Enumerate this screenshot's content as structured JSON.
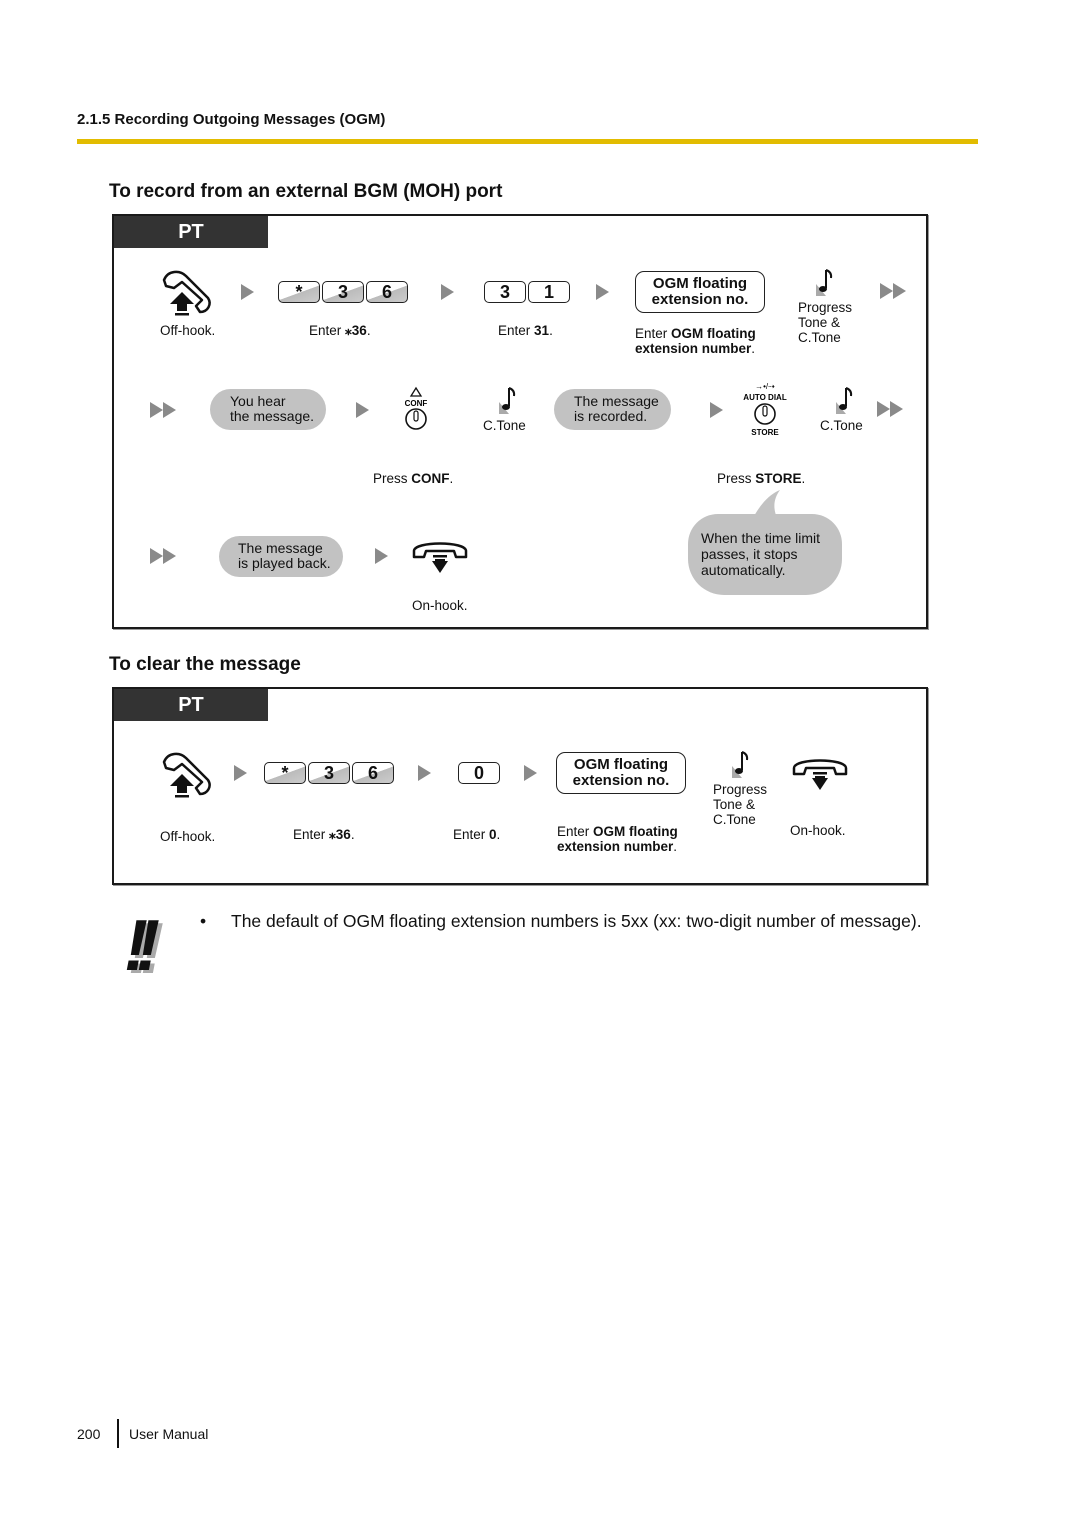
{
  "header": {
    "section": "2.1.5 Recording Outgoing Messages (OGM)",
    "accent_color": "#e2bc00"
  },
  "record_section": {
    "title": "To record from an external BGM (MOH) port",
    "badge": "PT",
    "row1": {
      "offhook_label": "Off-hook.",
      "keys_a": [
        "*",
        "3",
        "6"
      ],
      "keys_a_label_prefix": "Enter ",
      "keys_a_label_bold": "⁎36",
      "keys_a_label_suffix": ".",
      "keys_b": [
        "3",
        "1"
      ],
      "keys_b_label_prefix": "Enter ",
      "keys_b_label_bold": "31",
      "keys_b_label_suffix": ".",
      "ogm_box_line1": "OGM floating",
      "ogm_box_line2": "extension no.",
      "ogm_label_prefix": "Enter ",
      "ogm_label_bold1": "OGM floating",
      "ogm_label_bold2": "extension number",
      "ogm_label_suffix": ".",
      "tone_line1": "Progress",
      "tone_line2": "Tone &",
      "tone_line3": "C.Tone"
    },
    "row2": {
      "pill1_line1": "You hear",
      "pill1_line2": "the message.",
      "conf_key_caption": "CONF",
      "conf_label_prefix": "Press ",
      "conf_label_bold": "CONF",
      "conf_label_suffix": ".",
      "tone1": "C.Tone",
      "pill2_line1": "The message",
      "pill2_line2": "is recorded.",
      "store_key_top": "AUTO DIAL",
      "store_key_bottom": "STORE",
      "store_label_prefix": "Press ",
      "store_label_bold": "STORE",
      "store_label_suffix": ".",
      "tone2": "C.Tone"
    },
    "row3": {
      "pill_line1": "The message",
      "pill_line2": "is played back.",
      "onhook_label": "On-hook.",
      "bubble_line1": "When the time limit",
      "bubble_line2": "passes, it stops",
      "bubble_line3": "automatically."
    }
  },
  "clear_section": {
    "title": "To clear the message",
    "badge": "PT",
    "offhook_label": "Off-hook.",
    "keys_a": [
      "*",
      "3",
      "6"
    ],
    "keys_a_label_prefix": "Enter ",
    "keys_a_label_bold": "⁎36",
    "keys_a_label_suffix": ".",
    "keys_b": [
      "0"
    ],
    "keys_b_label_prefix": "Enter ",
    "keys_b_label_bold": "0",
    "keys_b_label_suffix": ".",
    "ogm_box_line1": "OGM floating",
    "ogm_box_line2": "extension no.",
    "ogm_label_prefix": "Enter ",
    "ogm_label_bold1": "OGM floating",
    "ogm_label_bold2": "extension number",
    "ogm_label_suffix": ".",
    "tone_line1": "Progress",
    "tone_line2": "Tone &",
    "tone_line3": "C.Tone",
    "onhook_label": "On-hook."
  },
  "note": {
    "icon": "!!",
    "bullet": "•",
    "text": "The default of OGM floating extension numbers is 5xx (xx: two-digit number of message)."
  },
  "footer": {
    "page_number": "200",
    "doc_title": "User Manual"
  }
}
